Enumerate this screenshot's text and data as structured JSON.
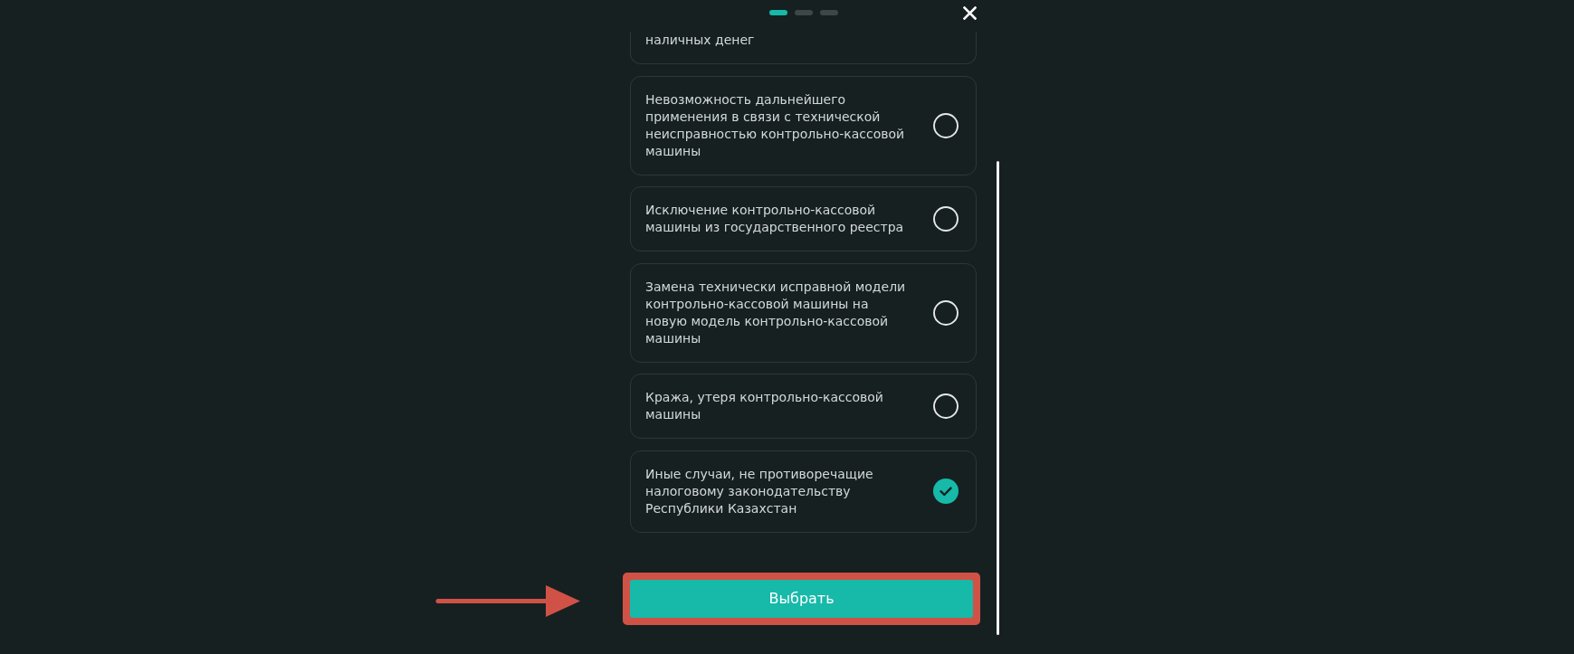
{
  "pager": {
    "steps": [
      {
        "selected": true
      },
      {
        "selected": false
      },
      {
        "selected": false
      }
    ]
  },
  "clipped_option": {
    "text": "наличных денег"
  },
  "options": [
    {
      "text": "Невозможность дальнейшего применения в связи с технической неисправностью контрольно-кассовой машины",
      "selected": false
    },
    {
      "text": "Исключение контрольно-кассовой машины из государственного реестра",
      "selected": false
    },
    {
      "text": "Замена технически исправной модели контрольно-кассовой машины на новую модель контрольно-кассовой машины",
      "selected": false
    },
    {
      "text": "Кража, утеря контрольно-кассовой машины",
      "selected": false
    },
    {
      "text": "Иные случаи, не противоречащие налоговому законодательству Республики Казахстан",
      "selected": true
    }
  ],
  "submit_button": {
    "label": "Выбрать"
  }
}
